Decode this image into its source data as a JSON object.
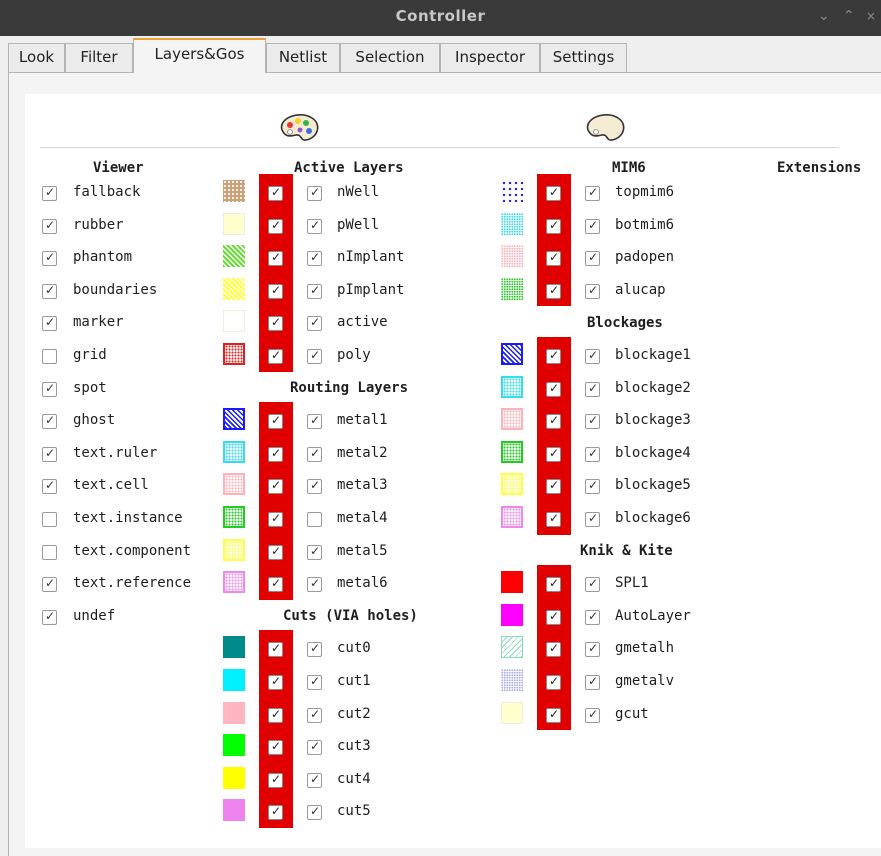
{
  "window": {
    "title": "Controller",
    "chevron_down": "⌄",
    "chevron_up": "⌃"
  },
  "tabs": [
    {
      "label": "Look"
    },
    {
      "label": "Filter"
    },
    {
      "label": "Layers&Gos"
    },
    {
      "label": "Netlist"
    },
    {
      "label": "Selection"
    },
    {
      "label": "Inspector"
    },
    {
      "label": "Settings"
    }
  ],
  "active_tab": "Layers&Gos",
  "viewer": {
    "title": "Viewer",
    "items": [
      {
        "label": "fallback",
        "checked": true
      },
      {
        "label": "rubber",
        "checked": true
      },
      {
        "label": "phantom",
        "checked": true
      },
      {
        "label": "boundaries",
        "checked": true
      },
      {
        "label": "marker",
        "checked": true
      },
      {
        "label": "grid",
        "checked": false
      },
      {
        "label": "spot",
        "checked": true
      },
      {
        "label": "ghost",
        "checked": true
      },
      {
        "label": "text.ruler",
        "checked": true
      },
      {
        "label": "text.cell",
        "checked": true
      },
      {
        "label": "text.instance",
        "checked": false
      },
      {
        "label": "text.component",
        "checked": false
      },
      {
        "label": "text.reference",
        "checked": true
      },
      {
        "label": "undef",
        "checked": true
      }
    ]
  },
  "column1": {
    "groups": [
      {
        "title": "Active Layers",
        "items": [
          {
            "label": "nWell",
            "checked": true,
            "color": "#c9a27a",
            "pattern": "dots"
          },
          {
            "label": "pWell",
            "checked": true,
            "color": "#ffffd0",
            "pattern": "solid-light"
          },
          {
            "label": "nImplant",
            "checked": true,
            "color": "#66dd33",
            "pattern": "diag"
          },
          {
            "label": "pImplant",
            "checked": true,
            "color": "#ffff33",
            "pattern": "diag"
          },
          {
            "label": "active",
            "checked": true,
            "color": "#ffffff",
            "pattern": "solid-light"
          },
          {
            "label": "poly",
            "checked": true,
            "color": "#e02020",
            "pattern": "dots-border"
          }
        ]
      },
      {
        "title": "Routing Layers",
        "items": [
          {
            "label": "metal1",
            "checked": true,
            "color": "#1a1aff",
            "pattern": "diag-border"
          },
          {
            "label": "metal2",
            "checked": true,
            "color": "#33ddee",
            "pattern": "dots-border"
          },
          {
            "label": "metal3",
            "checked": true,
            "color": "#ffb0b8",
            "pattern": "dots-border"
          },
          {
            "label": "metal4",
            "checked": false,
            "color": "#22cc22",
            "pattern": "dots-border"
          },
          {
            "label": "metal5",
            "checked": true,
            "color": "#ffff44",
            "pattern": "dots-border"
          },
          {
            "label": "metal6",
            "checked": true,
            "color": "#ee88ee",
            "pattern": "dots-border"
          }
        ]
      },
      {
        "title": "Cuts (VIA holes)",
        "items": [
          {
            "label": "cut0",
            "checked": true,
            "color": "#008b8b",
            "pattern": "solid"
          },
          {
            "label": "cut1",
            "checked": true,
            "color": "#00f0ff",
            "pattern": "solid"
          },
          {
            "label": "cut2",
            "checked": true,
            "color": "#ffb6c1",
            "pattern": "solid"
          },
          {
            "label": "cut3",
            "checked": true,
            "color": "#00ff00",
            "pattern": "solid"
          },
          {
            "label": "cut4",
            "checked": true,
            "color": "#ffff00",
            "pattern": "solid"
          },
          {
            "label": "cut5",
            "checked": true,
            "color": "#ee82ee",
            "pattern": "solid"
          }
        ]
      }
    ]
  },
  "column2": {
    "groups": [
      {
        "title": "MIM6",
        "items": [
          {
            "label": "topmim6",
            "checked": true,
            "color": "#1a1aff",
            "pattern": "sparse-dots"
          },
          {
            "label": "botmim6",
            "checked": true,
            "color": "#33ddee",
            "pattern": "fine-dots"
          },
          {
            "label": "padopen",
            "checked": true,
            "color": "#ffb0b8",
            "pattern": "fine-dots"
          },
          {
            "label": "alucap",
            "checked": true,
            "color": "#22cc22",
            "pattern": "fine-dots"
          }
        ]
      },
      {
        "title": "Blockages",
        "items": [
          {
            "label": "blockage1",
            "checked": true,
            "color": "#1a1aff",
            "pattern": "diag-border"
          },
          {
            "label": "blockage2",
            "checked": true,
            "color": "#33ddee",
            "pattern": "dots-border"
          },
          {
            "label": "blockage3",
            "checked": true,
            "color": "#ffb0b8",
            "pattern": "dots-border"
          },
          {
            "label": "blockage4",
            "checked": true,
            "color": "#22cc22",
            "pattern": "dots-border"
          },
          {
            "label": "blockage5",
            "checked": true,
            "color": "#ffff44",
            "pattern": "dots-border"
          },
          {
            "label": "blockage6",
            "checked": true,
            "color": "#ee88ee",
            "pattern": "dots-border"
          }
        ]
      },
      {
        "title": "Knik & Kite",
        "items": [
          {
            "label": "SPL1",
            "checked": true,
            "color": "#ff0000",
            "pattern": "solid"
          },
          {
            "label": "AutoLayer",
            "checked": true,
            "color": "#ff00ff",
            "pattern": "solid"
          },
          {
            "label": "gmetalh",
            "checked": true,
            "color": "#88ddbb",
            "pattern": "diag-light"
          },
          {
            "label": "gmetalv",
            "checked": true,
            "color": "#aaaaee",
            "pattern": "fine-dots"
          },
          {
            "label": "gcut",
            "checked": true,
            "color": "#ffffd0",
            "pattern": "solid-light"
          }
        ]
      }
    ]
  },
  "extensions": {
    "title": "Extensions"
  },
  "icons": {
    "palette": "palette-icon",
    "check": "✓"
  }
}
